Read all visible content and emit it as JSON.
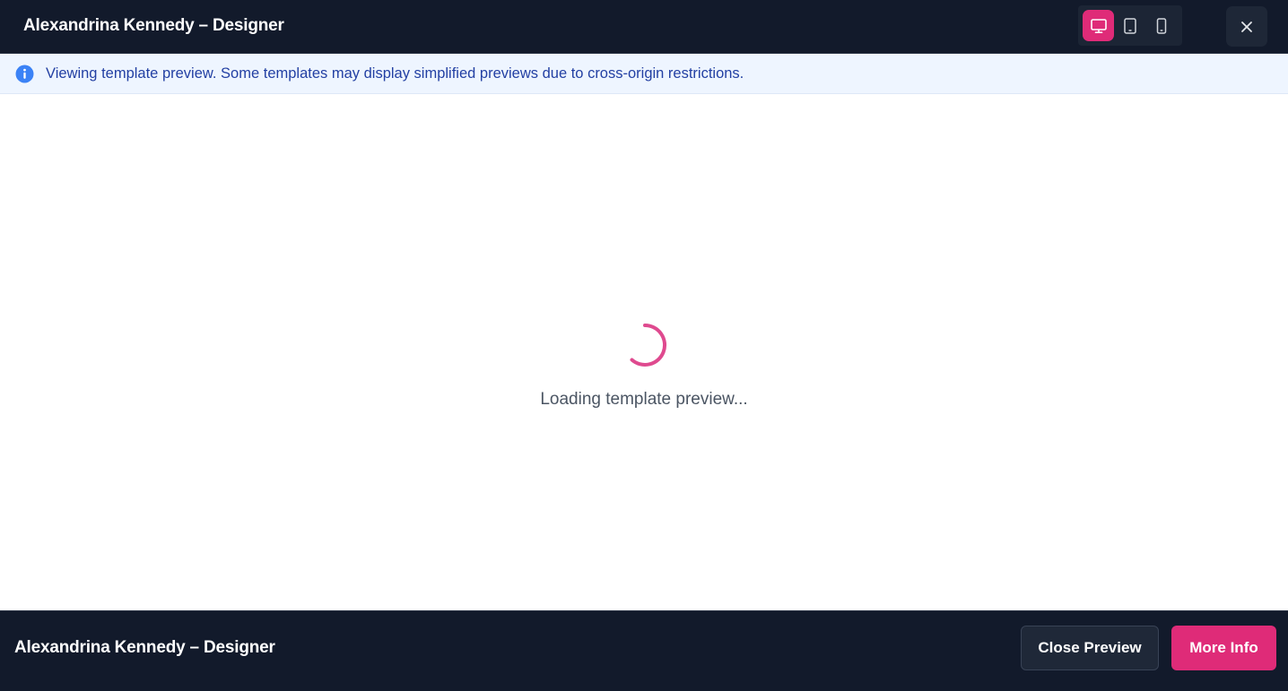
{
  "header": {
    "title": "Alexandrina Kennedy – Designer",
    "devices": [
      {
        "name": "desktop",
        "icon": "desktop-icon",
        "active": true
      },
      {
        "name": "tablet",
        "icon": "tablet-icon",
        "active": false
      },
      {
        "name": "mobile",
        "icon": "mobile-icon",
        "active": false
      }
    ],
    "close_icon": "close-icon"
  },
  "banner": {
    "icon": "info-icon",
    "text": "Viewing template preview. Some templates may display simplified previews due to cross-origin restrictions."
  },
  "preview": {
    "spinner_icon": "loading-spinner-icon",
    "loading_text": "Loading template preview..."
  },
  "footer": {
    "title": "Alexandrina Kennedy – Designer",
    "close_preview_label": "Close Preview",
    "more_info_label": "More Info"
  },
  "colors": {
    "dark_bg": "#121a2b",
    "accent": "#df2b78",
    "banner_bg": "#eef5ff",
    "banner_text": "#2340a3",
    "info_icon": "#3b82f6"
  }
}
